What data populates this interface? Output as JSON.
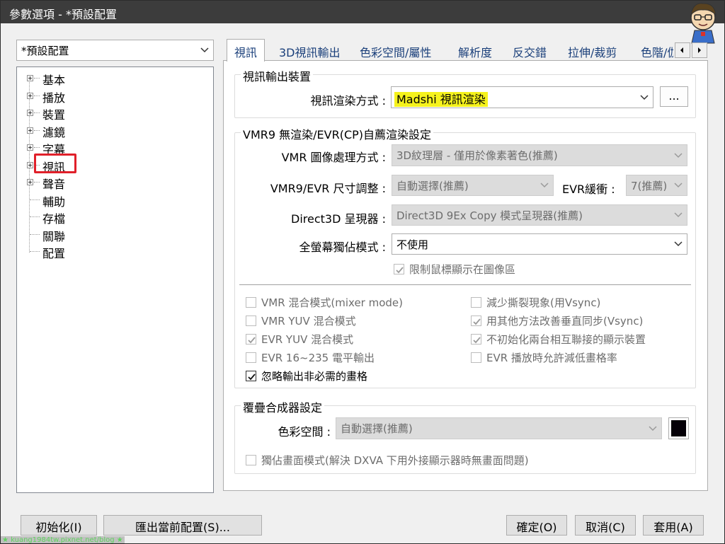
{
  "window": {
    "title": "參數選項 - *預設配置"
  },
  "profile_combo": {
    "value": "*預設配置"
  },
  "tree": {
    "items": [
      {
        "label": "基本",
        "expandable": true
      },
      {
        "label": "播放",
        "expandable": true
      },
      {
        "label": "裝置",
        "expandable": true
      },
      {
        "label": "濾鏡",
        "expandable": true
      },
      {
        "label": "字幕",
        "expandable": true
      },
      {
        "label": "視訊",
        "expandable": true,
        "highlighted": true
      },
      {
        "label": "聲音",
        "expandable": true
      },
      {
        "label": "輔助",
        "expandable": false
      },
      {
        "label": "存檔",
        "expandable": false
      },
      {
        "label": "關聯",
        "expandable": false
      },
      {
        "label": "配置",
        "expandable": false
      }
    ]
  },
  "tabs": [
    "視訊",
    "3D視訊輸出",
    "色彩空間/屬性",
    "解析度",
    "反交錯",
    "拉伸/裁剪",
    "色階/伽"
  ],
  "active_tab": "視訊",
  "output_group": {
    "title": "視訊輸出裝置",
    "renderer_label": "視訊渲染方式 :",
    "renderer_value": "Madshi 視訊渲染",
    "renderer_btn": "...",
    "highlight_color": "#f5f21c"
  },
  "vmr_group": {
    "title": "VMR9 無渲染/EVR(CP)自薦渲染設定",
    "processing_label": "VMR 圖像處理方式 :",
    "processing_value": "3D紋理層 - 僅用於像素著色(推薦)",
    "resize_label": "VMR9/EVR 尺寸調整 :",
    "resize_value": "自動選擇(推薦)",
    "evr_buffer_label": "EVR緩衝 :",
    "evr_buffer_value": "7(推薦)",
    "d3d_label": "Direct3D 呈現器 :",
    "d3d_value": "Direct3D 9Ex Copy 模式呈現器(推薦)",
    "fullscreen_label": "全螢幕獨佔模式 :",
    "fullscreen_value": "不使用",
    "limit_cursor": {
      "label": "限制鼠標顯示在圖像區",
      "checked": true,
      "enabled": false
    },
    "checks_left": [
      {
        "label": "VMR 混合模式(mixer mode)",
        "checked": false,
        "enabled": false
      },
      {
        "label": "VMR YUV 混合模式",
        "checked": false,
        "enabled": false
      },
      {
        "label": "EVR YUV 混合模式",
        "checked": true,
        "enabled": false
      },
      {
        "label": "EVR 16~235 電平輸出",
        "checked": false,
        "enabled": false
      },
      {
        "label": "忽略輸出非必需的畫格",
        "checked": true,
        "enabled": true
      }
    ],
    "checks_right": [
      {
        "label": "減少撕裂現象(用Vsync)",
        "checked": false,
        "enabled": false
      },
      {
        "label": "用其他方法改善垂直同步(Vsync)",
        "checked": true,
        "enabled": false
      },
      {
        "label": "不初始化兩台相互聯接的顯示裝置",
        "checked": true,
        "enabled": false
      },
      {
        "label": "EVR 播放時允許減低畫格率",
        "checked": false,
        "enabled": false
      }
    ]
  },
  "overlay_group": {
    "title": "覆疊合成器設定",
    "colorspace_label": "色彩空間 :",
    "colorspace_value": "自動選擇(推薦)",
    "swatch_color": "#050008",
    "exclusive": {
      "label": "獨佔畫面模式(解決 DXVA 下用外接顯示器時無畫面問題)",
      "checked": false,
      "enabled": false
    }
  },
  "buttons": {
    "reset": "初始化(I)",
    "export": "匯出當前配置(S)...",
    "ok": "確定(O)",
    "cancel": "取消(C)",
    "apply": "套用(A)"
  },
  "watermark": "★ kuang1984tw.pixnet.net/blog ★"
}
